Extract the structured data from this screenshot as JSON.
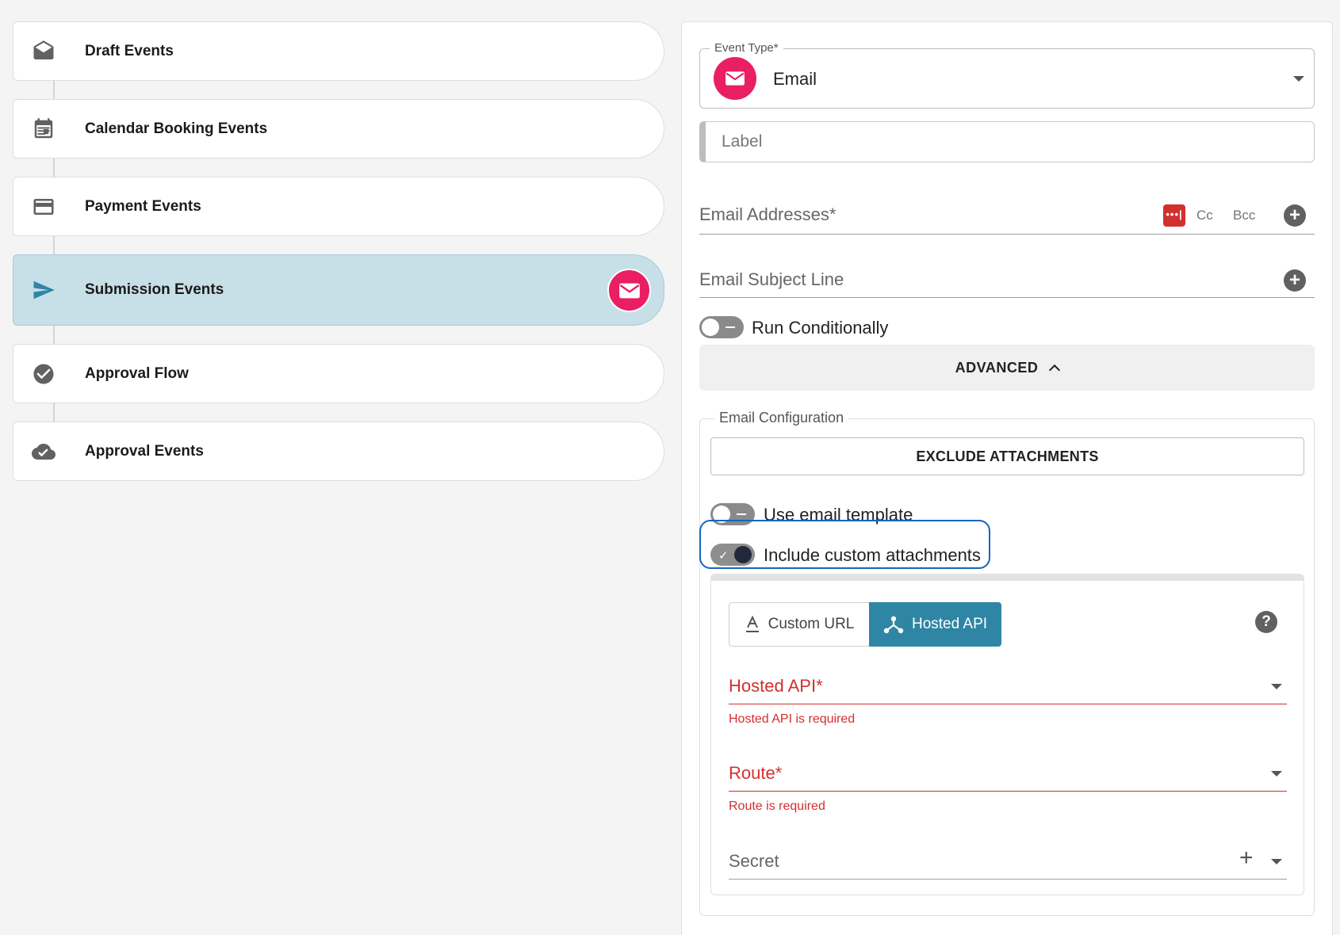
{
  "events": [
    {
      "label": "Draft Events",
      "icon": "drafts-icon"
    },
    {
      "label": "Calendar Booking Events",
      "icon": "calendar-icon"
    },
    {
      "label": "Payment Events",
      "icon": "credit-card-icon"
    },
    {
      "label": "Submission Events",
      "icon": "send-icon",
      "active": true
    },
    {
      "label": "Approval Flow",
      "icon": "check-circle-icon"
    },
    {
      "label": "Approval Events",
      "icon": "cloud-done-icon"
    }
  ],
  "form": {
    "event_type_legend": "Event Type*",
    "event_type_value": "Email",
    "label_placeholder": "Label",
    "email_addresses_placeholder": "Email Addresses*",
    "lastpass_icon_text": "•••|",
    "cc_label": "Cc",
    "bcc_label": "Bcc",
    "subject_placeholder": "Email Subject Line",
    "run_conditionally_label": "Run Conditionally",
    "advanced_label": "ADVANCED",
    "email_config_legend": "Email Configuration",
    "exclude_attachments_label": "EXCLUDE ATTACHMENTS",
    "use_template_label": "Use email template",
    "include_custom_label": "Include custom attachments",
    "tab_custom_url": "Custom URL",
    "tab_hosted_api": "Hosted API",
    "help_text": "?",
    "hosted_api_placeholder": "Hosted API*",
    "hosted_api_error": "Hosted API is required",
    "route_placeholder": "Route*",
    "route_error": "Route is required",
    "secret_placeholder": "Secret"
  },
  "colors": {
    "accent_pink": "#e91e63",
    "active_bg": "#c7dfe7",
    "send_teal": "#2e86a4",
    "error_red": "#d32f2f",
    "focus_blue": "#1565c0"
  }
}
